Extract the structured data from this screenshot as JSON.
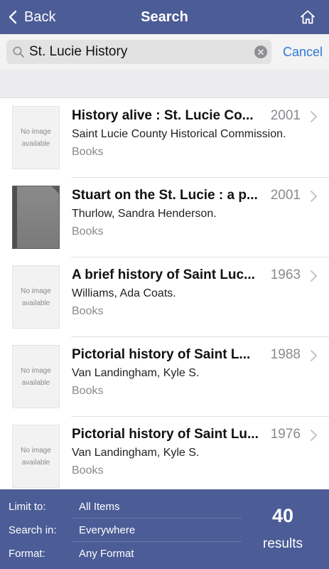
{
  "navbar": {
    "back_label": "Back",
    "title": "Search",
    "home_icon": "home-icon",
    "background": "#4b5c96"
  },
  "search": {
    "query": "St. Lucie History",
    "cancel_label": "Cancel",
    "accent": "#2b78d8"
  },
  "results": [
    {
      "title": "History alive : St. Lucie Co...",
      "year": "2001",
      "author": "Saint Lucie County Historical Commission.",
      "type": "Books",
      "thumb_line1": "No image",
      "thumb_line2": "available",
      "has_cover": false
    },
    {
      "title": "Stuart on the St. Lucie : a p...",
      "year": "2001",
      "author": "Thurlow, Sandra Henderson.",
      "type": "Books",
      "thumb_line1": "",
      "thumb_line2": "",
      "has_cover": true
    },
    {
      "title": "A brief history of Saint Luc...",
      "year": "1963",
      "author": "Williams, Ada Coats.",
      "type": "Books",
      "thumb_line1": "No image",
      "thumb_line2": "available",
      "has_cover": false
    },
    {
      "title": "Pictorial history of Saint L...",
      "year": "1988",
      "author": "Van Landingham, Kyle S.",
      "type": "Books",
      "thumb_line1": "No image",
      "thumb_line2": "available",
      "has_cover": false
    },
    {
      "title": "Pictorial history of Saint Lu...",
      "year": "1976",
      "author": "Van Landingham, Kyle S.",
      "type": "Books",
      "thumb_line1": "No image",
      "thumb_line2": "available",
      "has_cover": false
    }
  ],
  "footer": {
    "limit_label": "Limit to:",
    "limit_value": "All Items",
    "search_in_label": "Search in:",
    "search_in_value": "Everywhere",
    "format_label": "Format:",
    "format_value": "Any Format",
    "count": "40",
    "count_label": "results"
  }
}
